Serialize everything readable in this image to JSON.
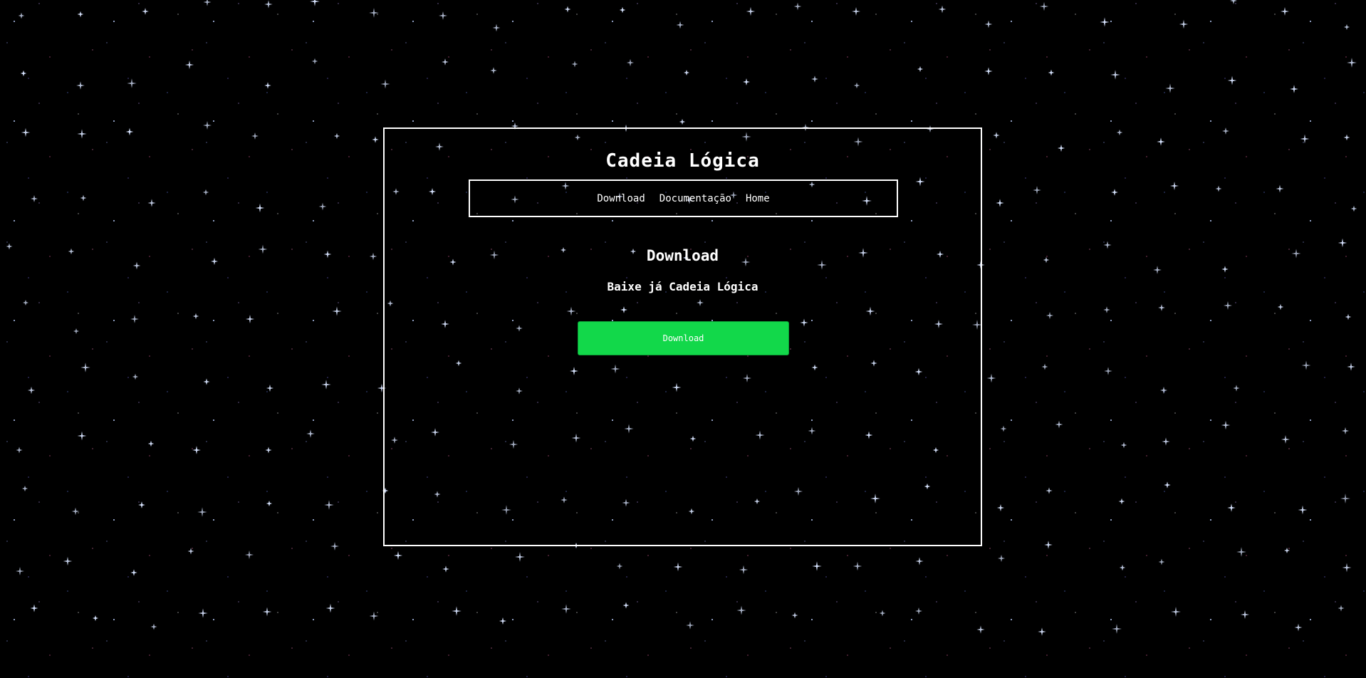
{
  "site": {
    "title": "Cadeia Lógica"
  },
  "nav": {
    "items": [
      {
        "label": "Download"
      },
      {
        "label": "Documentação"
      },
      {
        "label": "Home"
      }
    ]
  },
  "main": {
    "heading": "Download",
    "subtitle": "Baixe já Cadeia Lógica",
    "download_button_label": "Download"
  },
  "colors": {
    "background": "#000000",
    "border": "#ffffff",
    "button": "#12d84a",
    "text": "#ffffff"
  },
  "icons": {
    "background_stars": "sparkle-star-icon"
  }
}
